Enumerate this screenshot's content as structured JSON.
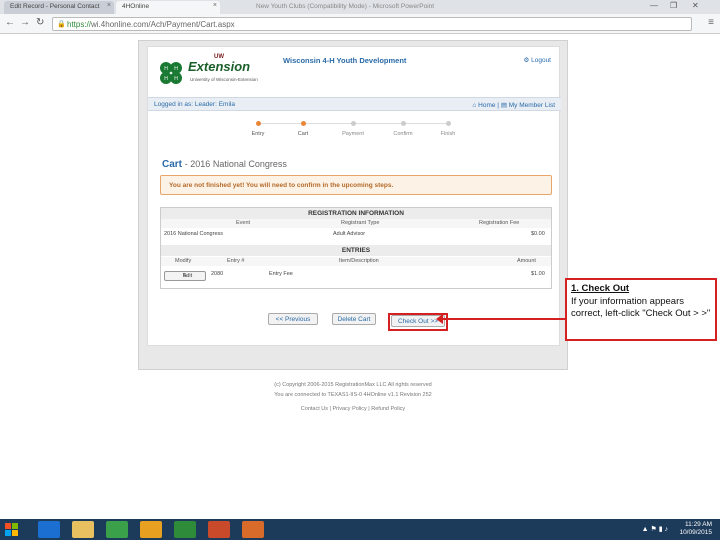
{
  "browser": {
    "tabs": [
      {
        "label": "Edit Record - Personal Contact"
      },
      {
        "label": "4HOnline"
      },
      {
        "label": "New Youth Clubs (Compatibility Mode) - Microsoft PowerPoint"
      }
    ],
    "url_scheme": "https://",
    "url_rest": "wi.4honline.com/Ach/Payment/Cart.aspx"
  },
  "header": {
    "logo_uw": "UW",
    "logo_main": "Extension",
    "logo_sub": "University of Wisconsin-Extension",
    "title": "Wisconsin 4-H Youth Development",
    "logout": "Logout"
  },
  "userbar": {
    "logged_in": "Logged in as: Leader: Emila",
    "home": "Home",
    "member_list": "My Member List"
  },
  "steps": [
    {
      "label": "Entry",
      "active": true
    },
    {
      "label": "Cart",
      "active": true
    },
    {
      "label": "Payment",
      "active": false
    },
    {
      "label": "Confirm",
      "active": false
    },
    {
      "label": "Finish",
      "active": false
    }
  ],
  "cart": {
    "title": "Cart",
    "subtitle": "- 2016 National Congress",
    "alert": "You are not finished yet! You will need to confirm in the upcoming steps."
  },
  "registration": {
    "section_title": "REGISTRATION INFORMATION",
    "columns": [
      "Event",
      "Registrant Type",
      "Registration Fee"
    ],
    "row": {
      "event": "2016 National Congress",
      "type": "Adult Advisor",
      "fee": "$0.00"
    }
  },
  "entries": {
    "section_title": "ENTRIES",
    "columns": [
      "Modify",
      "Entry #",
      "Item/Description",
      "Amount"
    ],
    "row": {
      "modify": "Edit",
      "entry": "2080",
      "item": "Entry Fee",
      "amount": "$1.00"
    }
  },
  "buttons": {
    "previous": "<< Previous",
    "delete_cart": "Delete Cart",
    "check_out": "Check Out >>"
  },
  "footer": {
    "copyright": "(c) Copyright 2006-2015 RegistrationMax LLC All rights reserved",
    "server": "You are connected to TEXAS1-IIS-0   4HOnline v1.1 Revision 252",
    "contact": "Contact Us",
    "privacy": "Privacy Policy",
    "refund": "Refund Policy"
  },
  "callout": {
    "title": "1. Check Out",
    "body": "If your information appears correct, left-click \"Check Out > >\""
  },
  "taskbar": {
    "time": "11:29 AM",
    "date": "10/09/2015",
    "app_colors": [
      "#1a6fd0",
      "#e8c060",
      "#3aa04a",
      "#e8a020",
      "#2e8b3a",
      "#c84a2a",
      "#d86a2a"
    ]
  },
  "colors": {
    "accent": "#2a6aa8",
    "alert_border": "#e8a56a",
    "highlight": "#d42020",
    "brand_green": "#1a5f2a"
  }
}
